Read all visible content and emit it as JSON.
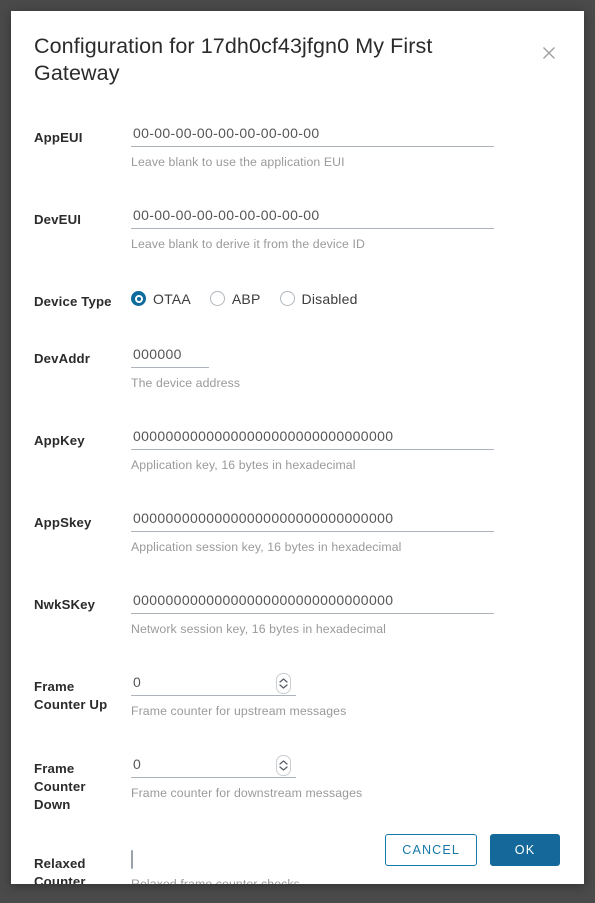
{
  "dialog": {
    "title": "Configuration for 17dh0cf43jfgn0 My First Gateway",
    "close_icon": "close-icon"
  },
  "fields": {
    "appeui": {
      "label": "AppEUI",
      "value": "00-00-00-00-00-00-00-00-00",
      "helper": "Leave blank to use the application EUI"
    },
    "deveui": {
      "label": "DevEUI",
      "value": "00-00-00-00-00-00-00-00-00",
      "helper": "Leave blank to derive it from the device ID"
    },
    "device_type": {
      "label": "Device Type",
      "selected": "OTAA",
      "options": [
        "OTAA",
        "ABP",
        "Disabled"
      ]
    },
    "devaddr": {
      "label": "DevAddr",
      "value": "000000",
      "helper": "The device address"
    },
    "appkey": {
      "label": "AppKey",
      "value": "00000000000000000000000000000000",
      "helper": "Application key, 16 bytes in hexadecimal"
    },
    "appskey": {
      "label": "AppSkey",
      "value": "00000000000000000000000000000000",
      "helper": "Application session key, 16 bytes in hexadecimal"
    },
    "nwkskey": {
      "label": "NwkSKey",
      "value": "00000000000000000000000000000000",
      "helper": "Network session key, 16 bytes in hexadecimal"
    },
    "frame_counter_up": {
      "label": "Frame Counter Up",
      "value": "0",
      "helper": "Frame counter for upstream messages"
    },
    "frame_counter_down": {
      "label": "Frame Counter Down",
      "value": "0",
      "helper": "Frame counter for downstream messages"
    },
    "relaxed_counter": {
      "label": "Relaxed Counter",
      "checked": false,
      "helper": "Relaxed frame counter checks"
    }
  },
  "footer": {
    "cancel_label": "CANCEL",
    "ok_label": "OK"
  },
  "colors": {
    "accent": "#15699a",
    "accent_border": "#1678a8",
    "radio_selected": "#0f6a9e",
    "backdrop": "#4a4a4a",
    "helper_text": "#9a9a9a"
  }
}
